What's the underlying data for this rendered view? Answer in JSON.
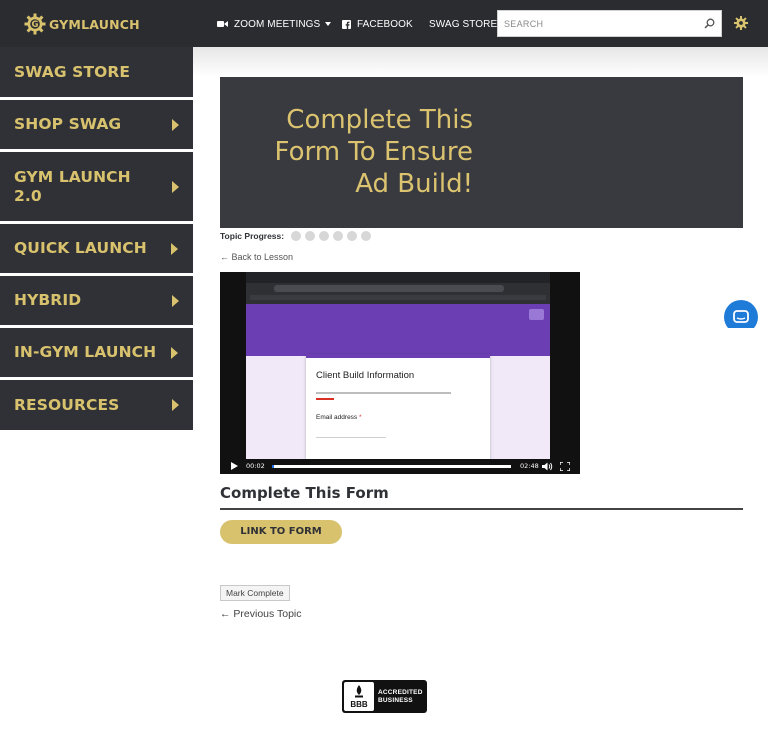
{
  "header": {
    "logo_text_a": "GYM",
    "logo_text_b": "LAUNCH",
    "nav": {
      "zoom": "ZOOM MEETINGS",
      "facebook": "FACEBOOK",
      "swag_store": "SWAG STORE"
    },
    "search": {
      "placeholder": "SEARCH",
      "value": ""
    }
  },
  "sidebar": {
    "items": [
      {
        "label": "SWAG STORE"
      },
      {
        "label": "SHOP SWAG"
      },
      {
        "label": "GYM LAUNCH 2.0"
      },
      {
        "label": "QUICK LAUNCH"
      },
      {
        "label": "HYBRID"
      },
      {
        "label": "IN-GYM LAUNCH"
      },
      {
        "label": "RESOURCES"
      }
    ]
  },
  "hero": {
    "line1": "Complete This",
    "line2": "Form To Ensure",
    "line3": "Ad Build!"
  },
  "progress": {
    "label": "Topic Progress:",
    "completed": 0,
    "total": 6
  },
  "back_link": "← Back to Lesson",
  "video": {
    "card_title": "Client Build Information",
    "email_label": "Email address",
    "email_required_mark": "*",
    "current_time": "00:02",
    "duration": "02:48",
    "played_fraction": 0.01
  },
  "section": {
    "title": "Complete This Form",
    "button": "LINK TO FORM"
  },
  "mark_complete": "Mark Complete",
  "previous_topic": "← Previous Topic",
  "badge": {
    "seal_text": "BBB",
    "line1": "ACCREDITED",
    "line2": "BUSINESS"
  },
  "colors": {
    "gold": "#d9c26e",
    "dark": "#2f3136",
    "hero_bg": "#383a3f",
    "form_purple": "#6b3fb3",
    "chat_blue": "#1f7bd8"
  }
}
